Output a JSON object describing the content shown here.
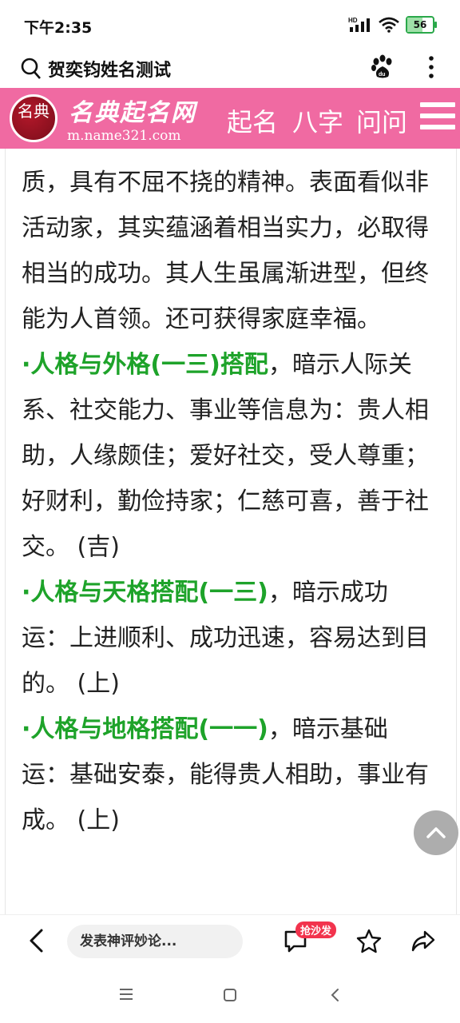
{
  "status": {
    "time": "下午2:35",
    "battery": "56"
  },
  "search": {
    "query": "贺奕钧姓名测试"
  },
  "site": {
    "logo_seal": "名典",
    "logo_name": "名典起名网",
    "logo_url": "m.name321.com",
    "nav": [
      "起名",
      "八字",
      "问问"
    ]
  },
  "article": {
    "intro": "质，具有不屈不挠的精神。表面看似非活动家，其实蕴涵着相当实力，必取得相当的成功。其人生虽属渐进型，但终能为人首领。还可获得家庭幸福。",
    "sections": [
      {
        "heading": "·人格与外格(一三)搭配",
        "text": "，暗示人际关系、社交能力、事业等信息为：贵人相助，人缘颇佳；爱好社交，受人尊重；好财利，勤俭持家；仁慈可喜，善于社交。 (吉)"
      },
      {
        "heading": "·人格与天格搭配(一三)",
        "text": "，暗示成功运：上进顺利、成功迅速，容易达到目的。 (上)"
      },
      {
        "heading": "·人格与地格搭配(一一)",
        "text": "，暗示基础运：基础安泰，能得贵人相助，事业有成。 (上)"
      }
    ]
  },
  "bottom": {
    "comment_placeholder": "发表神评妙论...",
    "badge": "抢沙发"
  },
  "colors": {
    "brand_pink": "#f06aa2",
    "green_heading": "#1ea32a",
    "badge_red": "#f2334d"
  }
}
